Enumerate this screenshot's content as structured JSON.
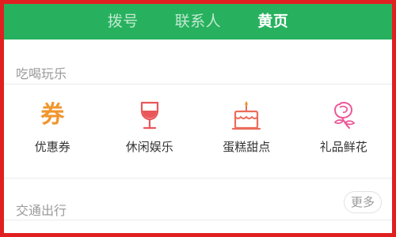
{
  "tabs": [
    {
      "label": "拨号",
      "active": false
    },
    {
      "label": "联系人",
      "active": false
    },
    {
      "label": "黄页",
      "active": true
    }
  ],
  "sections": {
    "food_fun": {
      "title": "吃喝玩乐",
      "items": [
        {
          "label": "优惠券",
          "icon": "coupon-icon",
          "color": "#f0962e",
          "glyph": "券"
        },
        {
          "label": "休闲娱乐",
          "icon": "wine-glass-icon",
          "color": "#e9575a"
        },
        {
          "label": "蛋糕甜点",
          "icon": "cake-icon",
          "color": "#ec6c5a"
        },
        {
          "label": "礼品鲜花",
          "icon": "rose-icon",
          "color": "#ec5a9a"
        }
      ]
    },
    "transport": {
      "title": "交通出行",
      "more_label": "更多"
    }
  },
  "colors": {
    "header_bg": "#27b15e",
    "frame_border": "#e02020"
  }
}
